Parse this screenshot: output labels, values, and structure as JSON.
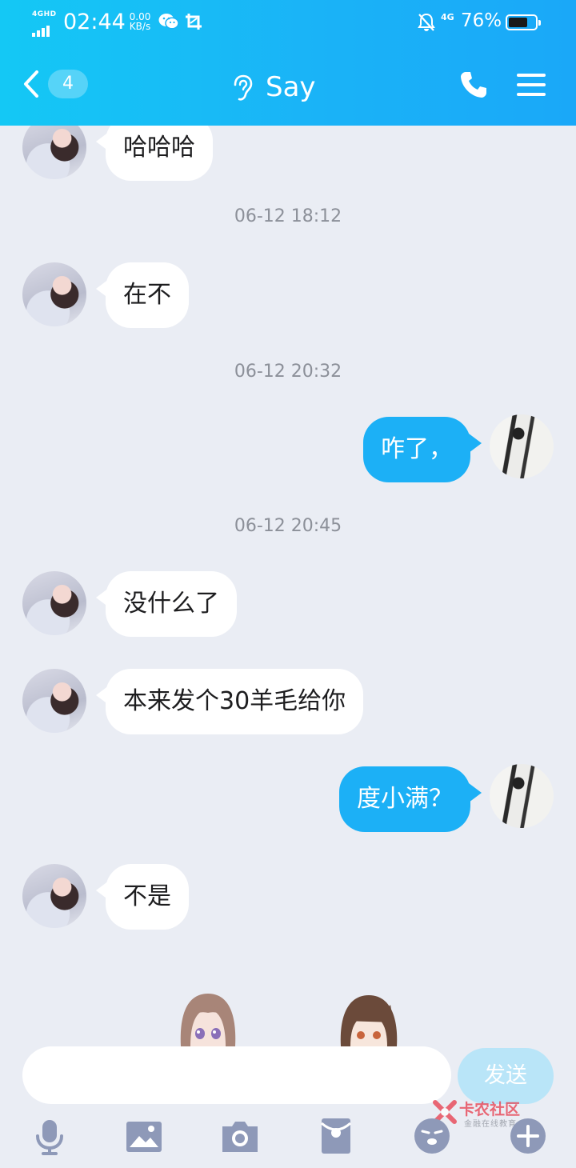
{
  "status_bar": {
    "network": "4GHD",
    "time": "02:44",
    "speed_value": "0.00",
    "speed_unit": "KB/s",
    "signal_label": "4G",
    "battery": "76%",
    "battery_level": 0.76
  },
  "header": {
    "unread_count": "4",
    "title": "Say"
  },
  "messages": [
    {
      "type": "in",
      "text": "哈哈哈"
    },
    {
      "type": "time",
      "text": "06-12 18:12"
    },
    {
      "type": "in",
      "text": "在不"
    },
    {
      "type": "time",
      "text": "06-12 20:32"
    },
    {
      "type": "out",
      "text": "咋了，"
    },
    {
      "type": "time",
      "text": "06-12 20:45"
    },
    {
      "type": "in",
      "text": "没什么了"
    },
    {
      "type": "in",
      "text": "本来发个30羊毛给你"
    },
    {
      "type": "out",
      "text": "度小满？"
    },
    {
      "type": "in",
      "text": "不是"
    }
  ],
  "composer": {
    "placeholder": "",
    "send_label": "发送"
  },
  "toolbar": {
    "icons": [
      "microphone-icon",
      "image-icon",
      "camera-icon",
      "red-packet-icon",
      "emoji-icon",
      "plus-icon"
    ]
  },
  "watermark": {
    "title": "卡农社区",
    "subtitle": "金融在线教育"
  },
  "colors": {
    "header": "#1ab3f7",
    "outgoing_bubble": "#1cb0f6",
    "incoming_bubble": "#ffffff",
    "background": "#eaedf4",
    "send_button": "#b9e5f8"
  }
}
